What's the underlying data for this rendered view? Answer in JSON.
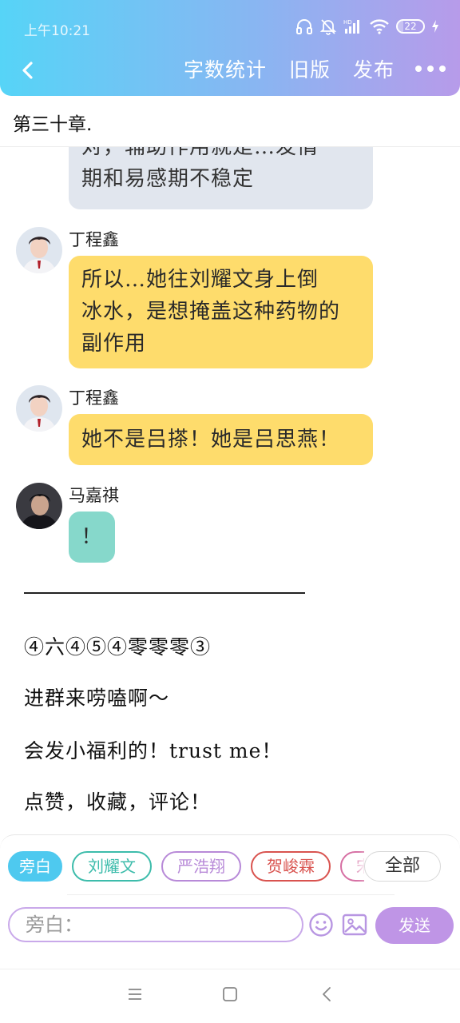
{
  "status_bar": {
    "time": "上午10:21",
    "battery": "22",
    "battery_level": 0.22,
    "icons": [
      "headphones-icon",
      "mute-icon",
      "hd-signal-icon",
      "wifi-icon",
      "battery-icon",
      "charging-icon"
    ]
  },
  "nav": {
    "back_icon": "chevron-left-icon",
    "word_count": "字数统计",
    "old_version": "旧版",
    "publish": "发布",
    "more_icon": "more-dots-icon"
  },
  "chapter": {
    "title": "第三十章."
  },
  "messages": [
    {
      "id": "m0",
      "speaker": "",
      "text_lines": [
        "对，辅助作用就是…发情",
        "期和易感期不稳定"
      ],
      "style": "gray"
    },
    {
      "id": "m1",
      "speaker": "丁程鑫",
      "text_lines": [
        "所以…她往刘耀文身上倒",
        "冰水，是想掩盖这种药物的",
        "副作用"
      ],
      "style": "yellow"
    },
    {
      "id": "m2",
      "speaker": "丁程鑫",
      "text_lines": [
        "她不是吕搽！她是吕思燕！"
      ],
      "style": "yellow"
    },
    {
      "id": "m3",
      "speaker": "马嘉祺",
      "text_lines": [
        "！"
      ],
      "style": "teal"
    }
  ],
  "author_note": {
    "lines": [
      "④六④⑤④零零零③",
      "进群来唠嗑啊～",
      "会发小福利的！trust me！",
      "点赞，收藏，评论！"
    ]
  },
  "input_panel": {
    "roles": [
      {
        "label": "旁白",
        "color": "#4ec9ef",
        "selected": true
      },
      {
        "label": "刘耀文",
        "color": "#3dbcab",
        "selected": false
      },
      {
        "label": "严浩翔",
        "color": "#b88ad8",
        "selected": false
      },
      {
        "label": "贺峻霖",
        "color": "#d9534f",
        "selected": false
      },
      {
        "label": "宋",
        "color": "#d66fa3",
        "selected": false
      }
    ],
    "all_button": "全部",
    "placeholder": "旁白：",
    "emoji_icon": "emoji-icon",
    "image_icon": "image-icon",
    "send": "发送"
  },
  "system_nav": {
    "icons": [
      "menu-icon",
      "home-icon",
      "back-icon"
    ]
  },
  "colors": {
    "header_gradient_start": "#56d4f7",
    "header_gradient_end": "#b79bea",
    "bubble_gray": "#e1e6ee",
    "bubble_yellow": "#fedc6c",
    "bubble_teal": "#86d8cb",
    "send_button": "#bf95e6"
  }
}
